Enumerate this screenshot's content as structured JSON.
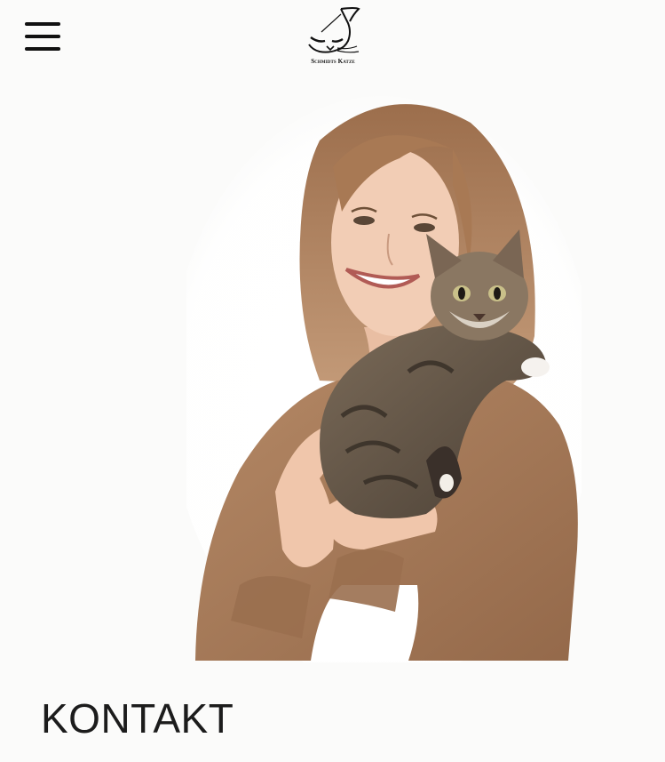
{
  "header": {
    "menu_icon": "hamburger-menu-icon",
    "logo_icon": "cat-logo-icon",
    "logo_text": "Schmidts Katze"
  },
  "hero": {
    "subject": "woman-holding-tabby-kitten",
    "colors": {
      "sweater": "#a67c5b",
      "hair": "#a87954",
      "skin": "#f0c9b0",
      "cat": "#6b5c4c",
      "shirt": "#ffffff"
    }
  },
  "section": {
    "heading": "KONTAKT"
  },
  "colors": {
    "background": "#fbfbfa",
    "text": "#1c1c1c"
  }
}
